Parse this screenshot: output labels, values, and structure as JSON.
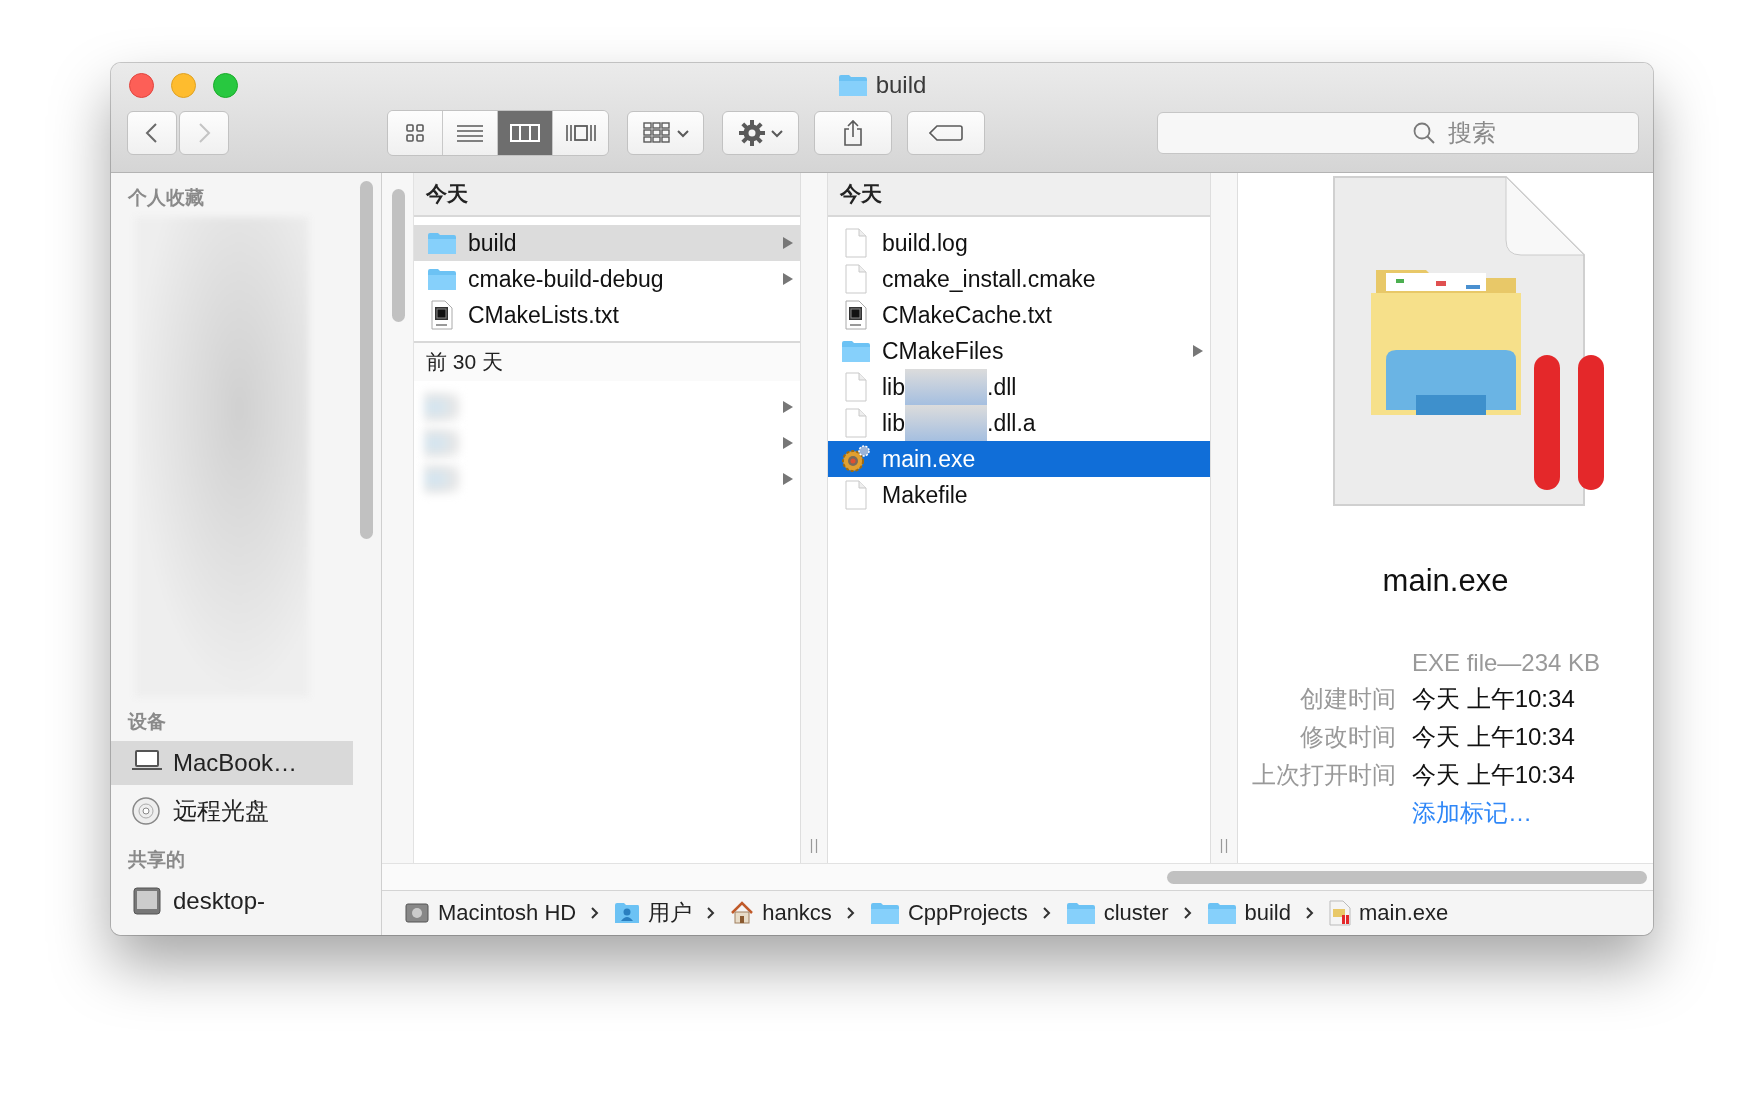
{
  "window": {
    "title": "build"
  },
  "toolbar": {
    "nav": [
      {
        "kind": "back",
        "disabled": false
      },
      {
        "kind": "forward",
        "disabled": true
      }
    ],
    "views": [
      {
        "kind": "icon",
        "selected": false
      },
      {
        "kind": "list",
        "selected": false
      },
      {
        "kind": "column",
        "selected": true
      },
      {
        "kind": "cover",
        "selected": false
      }
    ],
    "search": {
      "placeholder": "搜索"
    }
  },
  "sidebar": {
    "sections": [
      {
        "title": "个人收藏",
        "redacted": true
      },
      {
        "title": "设备",
        "items": [
          {
            "kind": "laptop",
            "label": "MacBook…",
            "selected": true
          },
          {
            "kind": "disc",
            "label": "远程光盘",
            "selected": false
          }
        ]
      },
      {
        "title": "共享的",
        "items": [
          {
            "kind": "computer",
            "label": "desktop-",
            "selected": false
          }
        ]
      }
    ]
  },
  "columns": [
    {
      "focused": false,
      "groups": [
        {
          "title": "今天",
          "items": [
            {
              "kind": "folder",
              "name": "build",
              "expandable": true,
              "selected": true
            },
            {
              "kind": "folder",
              "name": "cmake-build-debug",
              "expandable": true,
              "selected": false
            },
            {
              "kind": "text",
              "name": "CMakeLists.txt",
              "expandable": false,
              "selected": false
            }
          ]
        },
        {
          "title": "前 30 天",
          "items": [
            {
              "kind": "redacted",
              "expandable": true,
              "selected": false
            },
            {
              "kind": "redacted",
              "expandable": true,
              "selected": false
            },
            {
              "kind": "redacted",
              "expandable": true,
              "selected": false
            }
          ]
        }
      ]
    },
    {
      "focused": true,
      "groups": [
        {
          "title": "今天",
          "items": [
            {
              "kind": "document",
              "name": "build.log",
              "expandable": false,
              "selected": false
            },
            {
              "kind": "document",
              "name": "cmake_install.cmake",
              "expandable": false,
              "selected": false
            },
            {
              "kind": "text",
              "name": "CMakeCache.txt",
              "expandable": false,
              "selected": false
            },
            {
              "kind": "folder",
              "name": "CMakeFiles",
              "expandable": true,
              "selected": false
            },
            {
              "kind": "document",
              "name": "lib",
              "name_end": ".dll",
              "expandable": false,
              "selected": false
            },
            {
              "kind": "document",
              "name": "lib",
              "name_end": ".dll.a",
              "expandable": false,
              "selected": false
            },
            {
              "kind": "exe",
              "name": "main.exe",
              "expandable": false,
              "selected": true
            },
            {
              "kind": "document",
              "name": "Makefile",
              "expandable": false,
              "selected": false
            }
          ]
        }
      ]
    }
  ],
  "preview": {
    "name": "main.exe",
    "summary": "EXE file—234 KB",
    "info": [
      {
        "label": "创建时间",
        "value": "今天 上午10:34"
      },
      {
        "label": "修改时间",
        "value": "今天 上午10:34"
      },
      {
        "label": "上次打开时间",
        "value": "今天 上午10:34"
      }
    ],
    "add_tags": "添加标记…"
  },
  "path_bar": [
    {
      "kind": "disk",
      "label": "Macintosh HD"
    },
    {
      "kind": "users",
      "label": "用户"
    },
    {
      "kind": "home",
      "label": "hankcs"
    },
    {
      "kind": "folder",
      "label": "CppProjects"
    },
    {
      "kind": "folder",
      "label": "cluster"
    },
    {
      "kind": "folder",
      "label": "build"
    },
    {
      "kind": "exe",
      "label": "main.exe"
    }
  ]
}
